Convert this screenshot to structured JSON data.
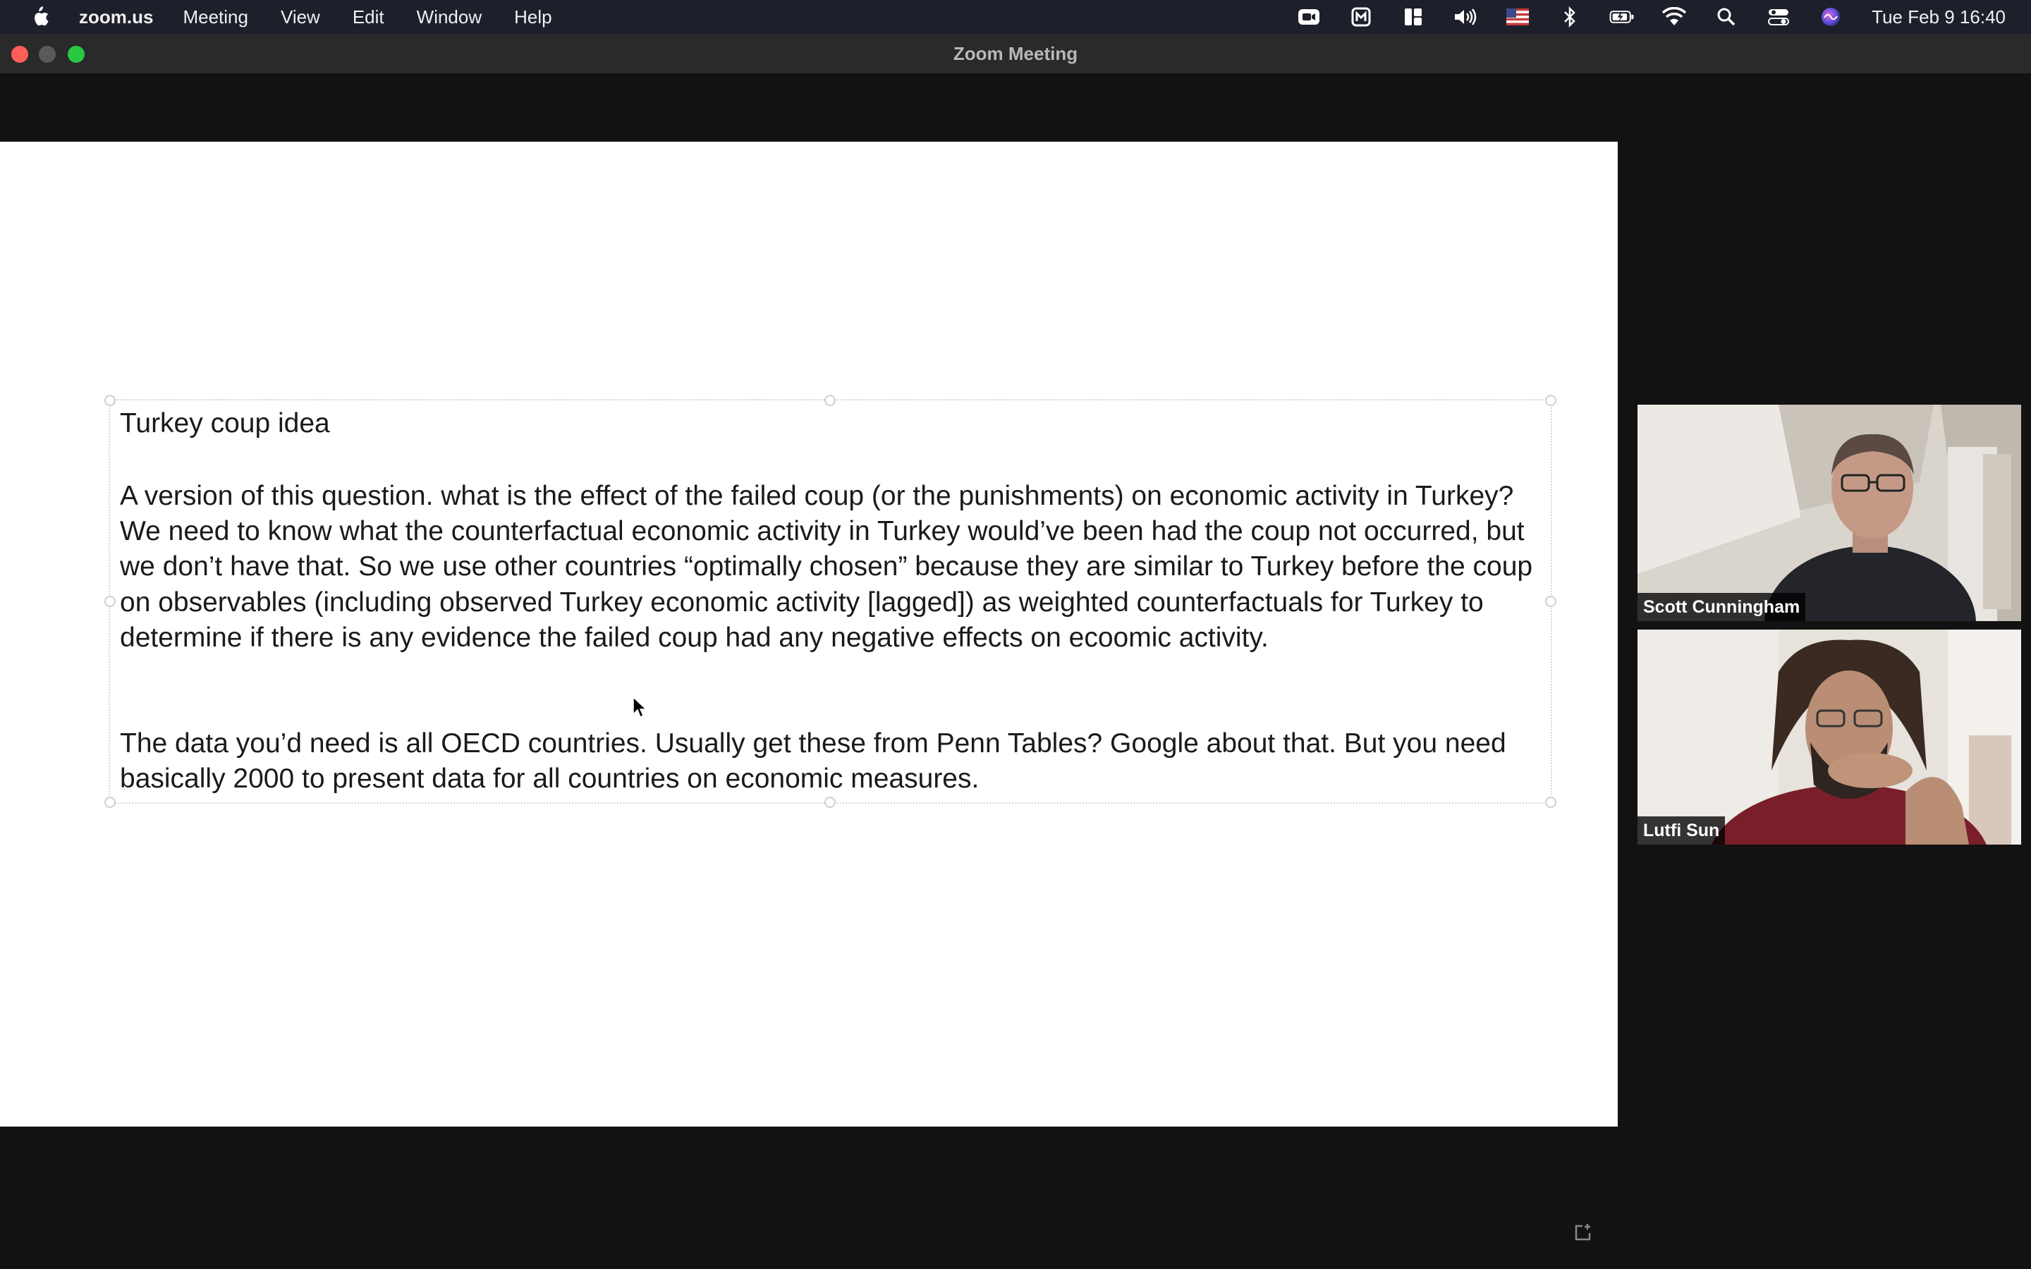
{
  "menubar": {
    "app_name": "zoom.us",
    "menus": [
      "Meeting",
      "View",
      "Edit",
      "Window",
      "Help"
    ],
    "status_icons": [
      "zoom-icon",
      "meet-icon",
      "layout-icon",
      "volume-icon",
      "us-flag-icon",
      "bluetooth-icon",
      "battery-icon",
      "wifi-icon",
      "search-icon",
      "control-center-icon",
      "siri-icon"
    ],
    "clock": "Tue Feb 9  16:40"
  },
  "window": {
    "title": "Zoom Meeting"
  },
  "shared_document": {
    "title": "Turkey coup idea",
    "paragraph1": "A version of this question.  what is the effect of the failed coup (or the punishments) on economic activity in Turkey?  We need to know what the counterfactual economic activity in Turkey would’ve been had the coup not occurred, but we don’t have that.  So we use other countries “optimally chosen” because they are similar to Turkey before the coup on observables (including observed Turkey economic activity [lagged]) as weighted counterfactuals for Turkey to determine if there is any evidence the failed coup had any negative effects on ecoomic activity.",
    "paragraph2": "The data you’d need is all OECD countries.  Usually get these from Penn Tables? Google about that.  But you need basically 2000 to present data for all countries on economic measures."
  },
  "participants": [
    {
      "name": "Scott Cunningham"
    },
    {
      "name": "Lutfi Sun"
    }
  ],
  "colors": {
    "menubar_bg": "#1d1f2a",
    "meeting_bg": "#121212",
    "close": "#fe5f57",
    "maximize": "#28c840"
  }
}
